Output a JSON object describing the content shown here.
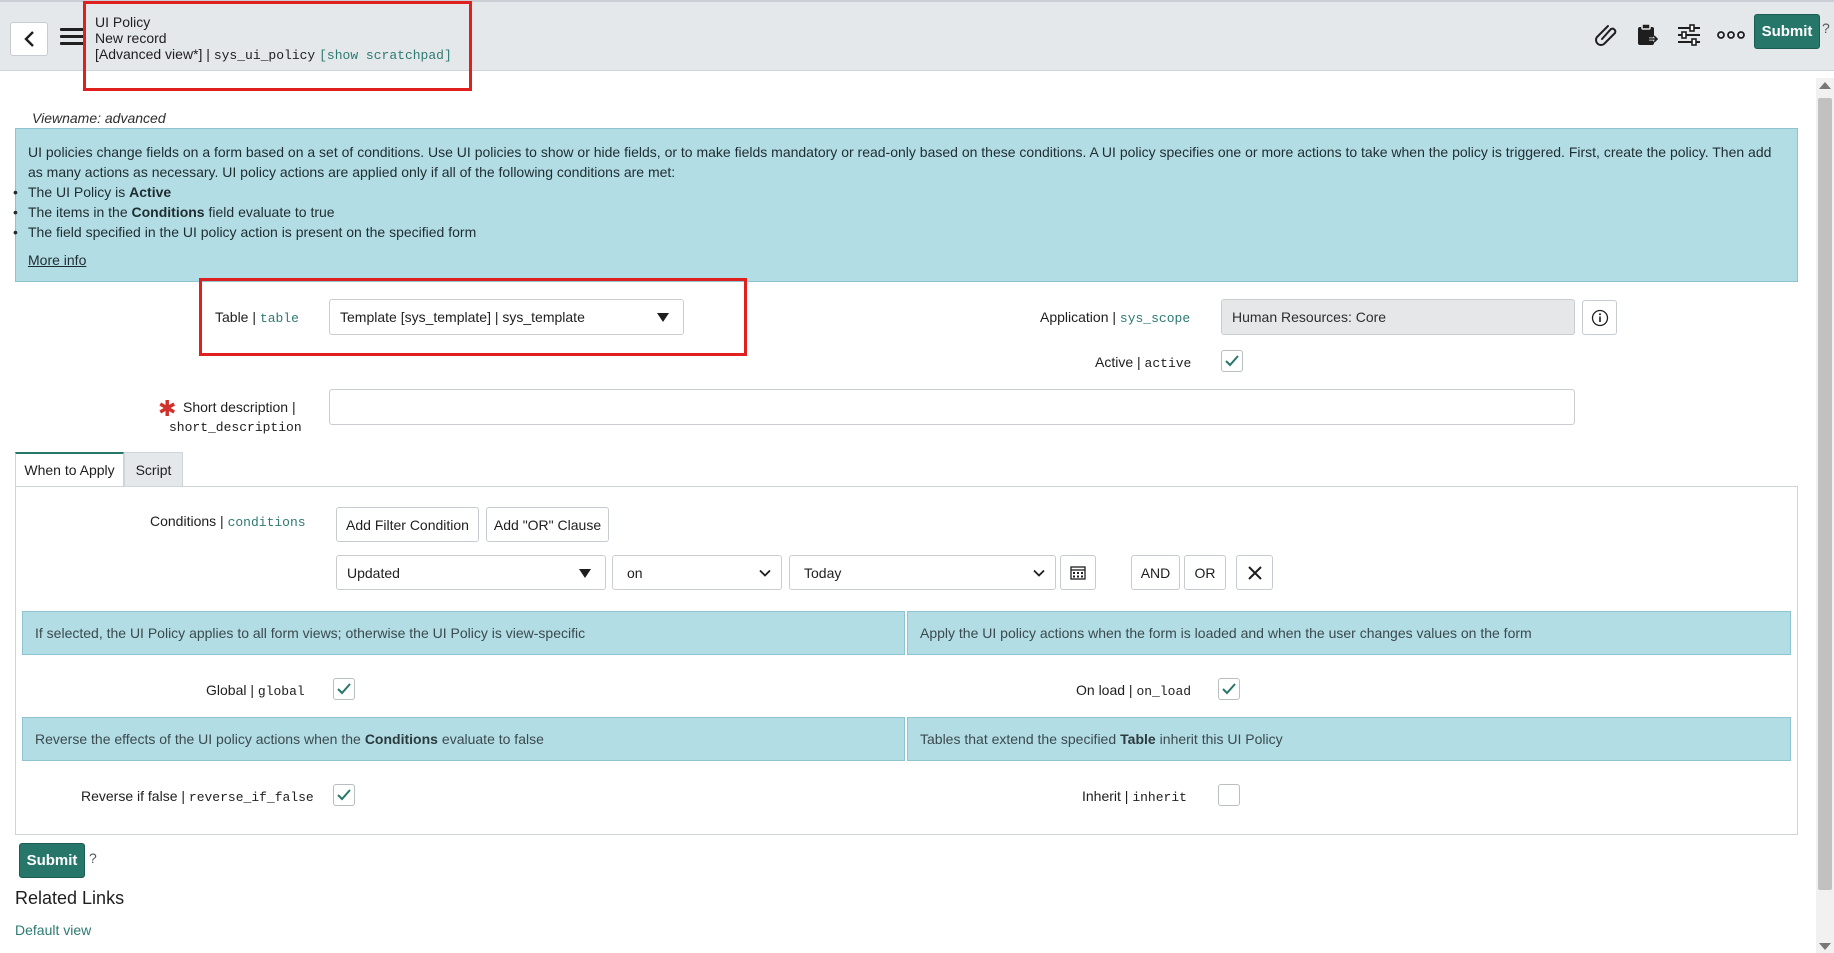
{
  "header": {
    "title": "UI Policy",
    "subtitle": "New record",
    "view_label": "[Advanced view*] | ",
    "table_name": "sys_ui_policy",
    "scratchpad_link": "[show scratchpad]",
    "submit_label": "Submit",
    "help_mark": "?"
  },
  "info": {
    "viewname": "Viewname: advanced",
    "description": "UI policies change fields on a form based on a set of conditions. Use UI policies to show or hide fields, or to make fields mandatory or read-only based on these conditions. A UI policy specifies one or more actions to take when the policy is triggered. First, create the policy. Then add as many actions as necessary. UI policy actions are applied only if all of the following conditions are met:",
    "bullets": [
      {
        "pre": "The UI Policy is ",
        "bold": "Active",
        "post": ""
      },
      {
        "pre": "The items in the ",
        "bold": "Conditions",
        "post": " field evaluate to true"
      },
      {
        "pre": "The field specified in the UI policy action is present on the specified form",
        "bold": "",
        "post": ""
      }
    ],
    "more_info": "More info"
  },
  "form": {
    "table_label": "Table | ",
    "table_field": "table",
    "table_value": "Template [sys_template] | sys_template",
    "application_label": "Application | ",
    "application_field": "sys_scope",
    "application_value": "Human Resources: Core",
    "active_label": "Active | ",
    "active_field": "active",
    "short_desc_label": "Short description |",
    "short_desc_field": "short_description",
    "short_desc_value": ""
  },
  "tabs": [
    {
      "label": "When to Apply"
    },
    {
      "label": "Script"
    }
  ],
  "conditions": {
    "label": "Conditions | ",
    "field": "conditions",
    "add_filter": "Add Filter Condition",
    "add_or": "Add \"OR\" Clause",
    "field_select": "Updated",
    "operator_select": "on",
    "value_select": "Today",
    "and_label": "AND",
    "or_label": "OR"
  },
  "options": {
    "global_hint": "If selected, the UI Policy applies to all form views; otherwise the UI Policy is view-specific",
    "onload_hint": "Apply the UI policy actions when the form is loaded and when the user changes values on the form",
    "global_label": "Global | ",
    "global_field": "global",
    "onload_label": "On load | ",
    "onload_field": "on_load",
    "reverse_hint_pre": "Reverse the effects of the UI policy actions when the ",
    "reverse_hint_bold": "Conditions",
    "reverse_hint_post": " evaluate to false",
    "inherit_hint_pre": "Tables that extend the specified ",
    "inherit_hint_bold": "Table",
    "inherit_hint_post": " inherit this UI Policy",
    "reverse_label": "Reverse if false | ",
    "reverse_field": "reverse_if_false",
    "inherit_label": "Inherit | ",
    "inherit_field": "inherit",
    "checked": {
      "active": true,
      "global": true,
      "on_load": true,
      "reverse_if_false": true,
      "inherit": false
    }
  },
  "footer": {
    "submit_label": "Submit",
    "help_mark": "?",
    "related_links": "Related Links",
    "default_view": "Default view"
  },
  "icons": [
    "back-icon",
    "menu-icon",
    "paperclip-icon",
    "clipboard-icon",
    "settings-sliders-icon",
    "more-icon",
    "info-icon",
    "calendar-icon",
    "close-icon",
    "check-icon"
  ],
  "colors": {
    "accent": "#27766a",
    "info_bg": "#b3dde5",
    "highlight": "#e0201f",
    "required": "#d0312d"
  }
}
